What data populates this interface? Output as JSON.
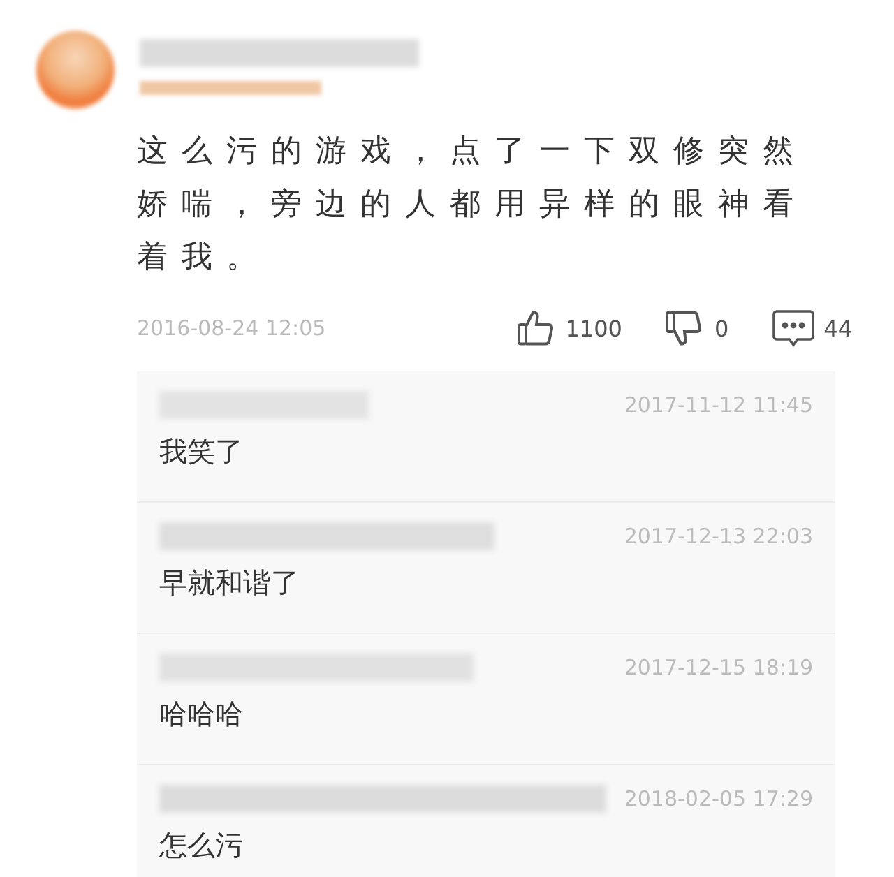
{
  "comment": {
    "text": "这么污的游戏，点了一下双修突然娇喘，旁边的人都用异样的眼神看着我。",
    "time": "2016-08-24 12:05",
    "likes": "1100",
    "dislikes": "0",
    "replies_count": "44"
  },
  "replies": [
    {
      "time": "2017-11-12 11:45",
      "text": "我笑了"
    },
    {
      "time": "2017-12-13 22:03",
      "text": "早就和谐了"
    },
    {
      "time": "2017-12-15 18:19",
      "text": "哈哈哈"
    },
    {
      "time": "2018-02-05 17:29",
      "text": "怎么污"
    }
  ]
}
